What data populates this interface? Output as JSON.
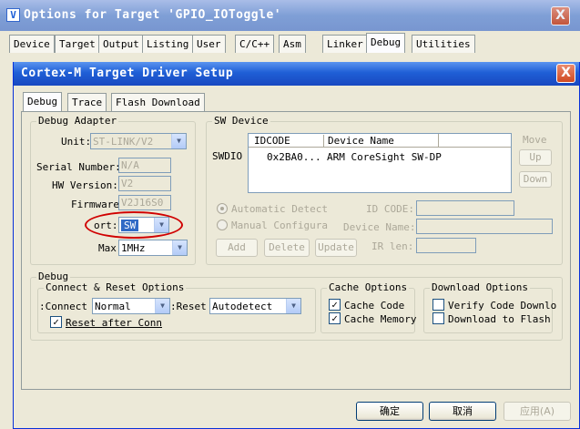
{
  "outer": {
    "title": "Options for Target 'GPIO_IOToggle'",
    "close": "X",
    "tabs": [
      "Device",
      "Target",
      "Output",
      "Listing",
      "User",
      "C/C++",
      "Asm",
      "Linker",
      "Debug",
      "Utilities"
    ],
    "active_tab": "Debug"
  },
  "dialog": {
    "title": "Cortex-M Target Driver Setup",
    "close": "X",
    "tabs": [
      "Debug",
      "Trace",
      "Flash Download"
    ],
    "active_tab": "Debug",
    "debug_adapter": {
      "group_label": "Debug Adapter",
      "unit_label": "Unit:",
      "unit_value": "ST-LINK/V2",
      "serial_label": "Serial Number:",
      "serial_value": "N/A",
      "hw_label": "HW Version:",
      "hw_value": "V2",
      "fw_label": "Firmware",
      "fw_value": "V2J16S0",
      "port_label": "ort:",
      "port_value": "SW",
      "max_label": "Max",
      "max_value": "1MHz"
    },
    "sw_device": {
      "group_label": "SW Device",
      "row_label": "SWDIO",
      "col_idcode": "IDCODE",
      "col_name": "Device Name",
      "rows": [
        {
          "idcode": "0x2BA0...",
          "name": "ARM CoreSight SW-DP"
        }
      ],
      "move_label": "Move",
      "up": "Up",
      "down": "Down",
      "auto_label": "Automatic Detectic",
      "manual_label": "Manual Configurati",
      "ir_code_label": "ID CODE:",
      "device_name_label": "Device Name:",
      "ir_len_label": "IR len:",
      "add": "Add",
      "delete": "Delete",
      "update": "Update"
    },
    "debug": {
      "group_label": "Debug",
      "connect_group": "Connect & Reset Options",
      "connect_label": "Connect:",
      "connect_value": "Normal",
      "reset_label": "Reset:",
      "reset_value": "Autodetect",
      "reset_after": "Reset after Conn",
      "cache_group": "Cache Options",
      "cache_code": "Cache Code",
      "cache_memory": "Cache Memory",
      "download_group": "Download Options",
      "verify": "Verify Code Downlo",
      "download_flash": "Download to Flash"
    },
    "buttons": {
      "ok": "确定",
      "cancel": "取消",
      "apply": "应用(A)"
    }
  },
  "colors": {
    "title_active": "#1f5fd6",
    "highlight_ellipse": "#d00000",
    "selection": "#316ac5"
  }
}
